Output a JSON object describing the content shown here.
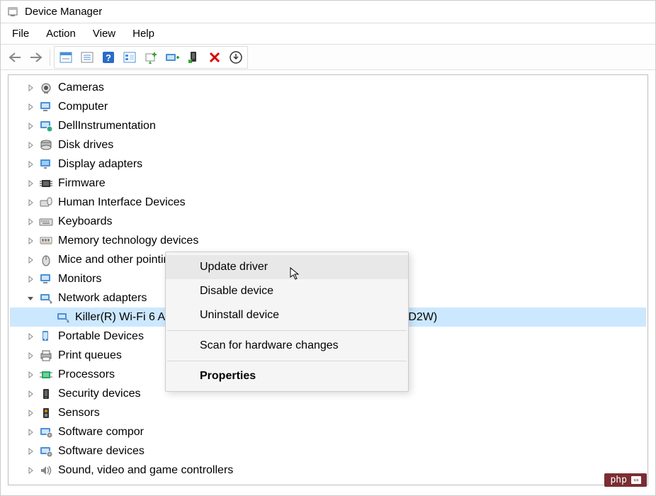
{
  "window": {
    "title": "Device Manager"
  },
  "menu": {
    "file": "File",
    "action": "Action",
    "view": "View",
    "help": "Help"
  },
  "tree": {
    "items": [
      {
        "label": "Cameras",
        "icon": "camera"
      },
      {
        "label": "Computer",
        "icon": "computer"
      },
      {
        "label": "DellInstrumentation",
        "icon": "diag"
      },
      {
        "label": "Disk drives",
        "icon": "disk"
      },
      {
        "label": "Display adapters",
        "icon": "display"
      },
      {
        "label": "Firmware",
        "icon": "chip"
      },
      {
        "label": "Human Interface Devices",
        "icon": "hid"
      },
      {
        "label": "Keyboards",
        "icon": "keyboard"
      },
      {
        "label": "Memory technology devices",
        "icon": "memory"
      },
      {
        "label": "Mice and other pointing devices",
        "icon": "mouse"
      },
      {
        "label": "Monitors",
        "icon": "monitor"
      },
      {
        "label": "Network adapters",
        "icon": "network",
        "expanded": true,
        "children": [
          {
            "label": "Killer(R) Wi-Fi 6 AX1650s 160MHz Wireless Network Adapter (201D2W)",
            "icon": "nic",
            "selected": true
          }
        ]
      },
      {
        "label": "Portable Devices",
        "icon": "portable"
      },
      {
        "label": "Print queues",
        "icon": "printer"
      },
      {
        "label": "Processors",
        "icon": "cpu"
      },
      {
        "label": "Security devices",
        "icon": "security"
      },
      {
        "label": "Sensors",
        "icon": "sensor"
      },
      {
        "label": "Software compor",
        "icon": "software"
      },
      {
        "label": "Software devices",
        "icon": "software"
      },
      {
        "label": "Sound, video and game controllers",
        "icon": "sound"
      }
    ]
  },
  "context_menu": {
    "update": "Update driver",
    "disable": "Disable device",
    "uninstall": "Uninstall device",
    "scan": "Scan for hardware changes",
    "properties": "Properties"
  },
  "watermark": {
    "text": "php"
  }
}
